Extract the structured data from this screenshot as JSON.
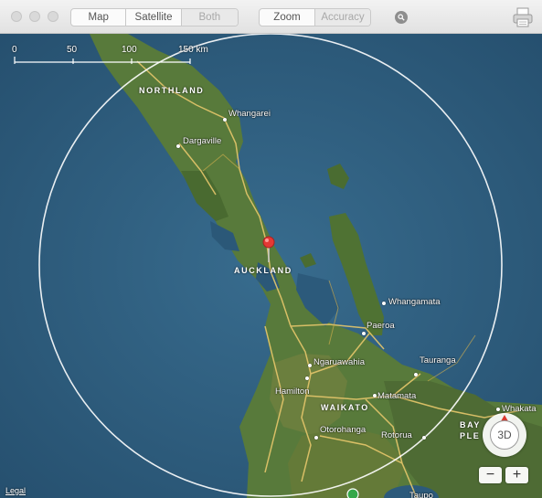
{
  "toolbar": {
    "map_type": {
      "options": [
        "Map",
        "Satellite",
        "Both"
      ],
      "selected": "Satellite",
      "disabled": "Both"
    },
    "view": {
      "options": [
        "Zoom",
        "Accuracy"
      ],
      "disabled": "Accuracy"
    },
    "search_icon": "magnifier-icon",
    "print_icon": "printer-icon"
  },
  "scale_bar": {
    "ticks": [
      "0",
      "50",
      "100",
      "150 km"
    ]
  },
  "regions": [
    "NORTHLAND",
    "AUCKLAND",
    "WAIKATO",
    "BAY",
    "PLE"
  ],
  "places": [
    "Whangarei",
    "Dargaville",
    "Whangamata",
    "Paeroa",
    "Tauranga",
    "Ngaruawahia",
    "Hamilton",
    "Matamata",
    "Whakata",
    "Otorohanga",
    "Rotorua",
    "Taupo"
  ],
  "legal": "Legal",
  "compass": {
    "label": "3D"
  },
  "zoom": {
    "minus": "−",
    "plus": "+"
  },
  "colors": {
    "sea": "#2f5f82",
    "land": "#5a7a3c",
    "road": "#e7c86e",
    "pin": "#e53935",
    "accuracy_circle": "#ffffff"
  }
}
